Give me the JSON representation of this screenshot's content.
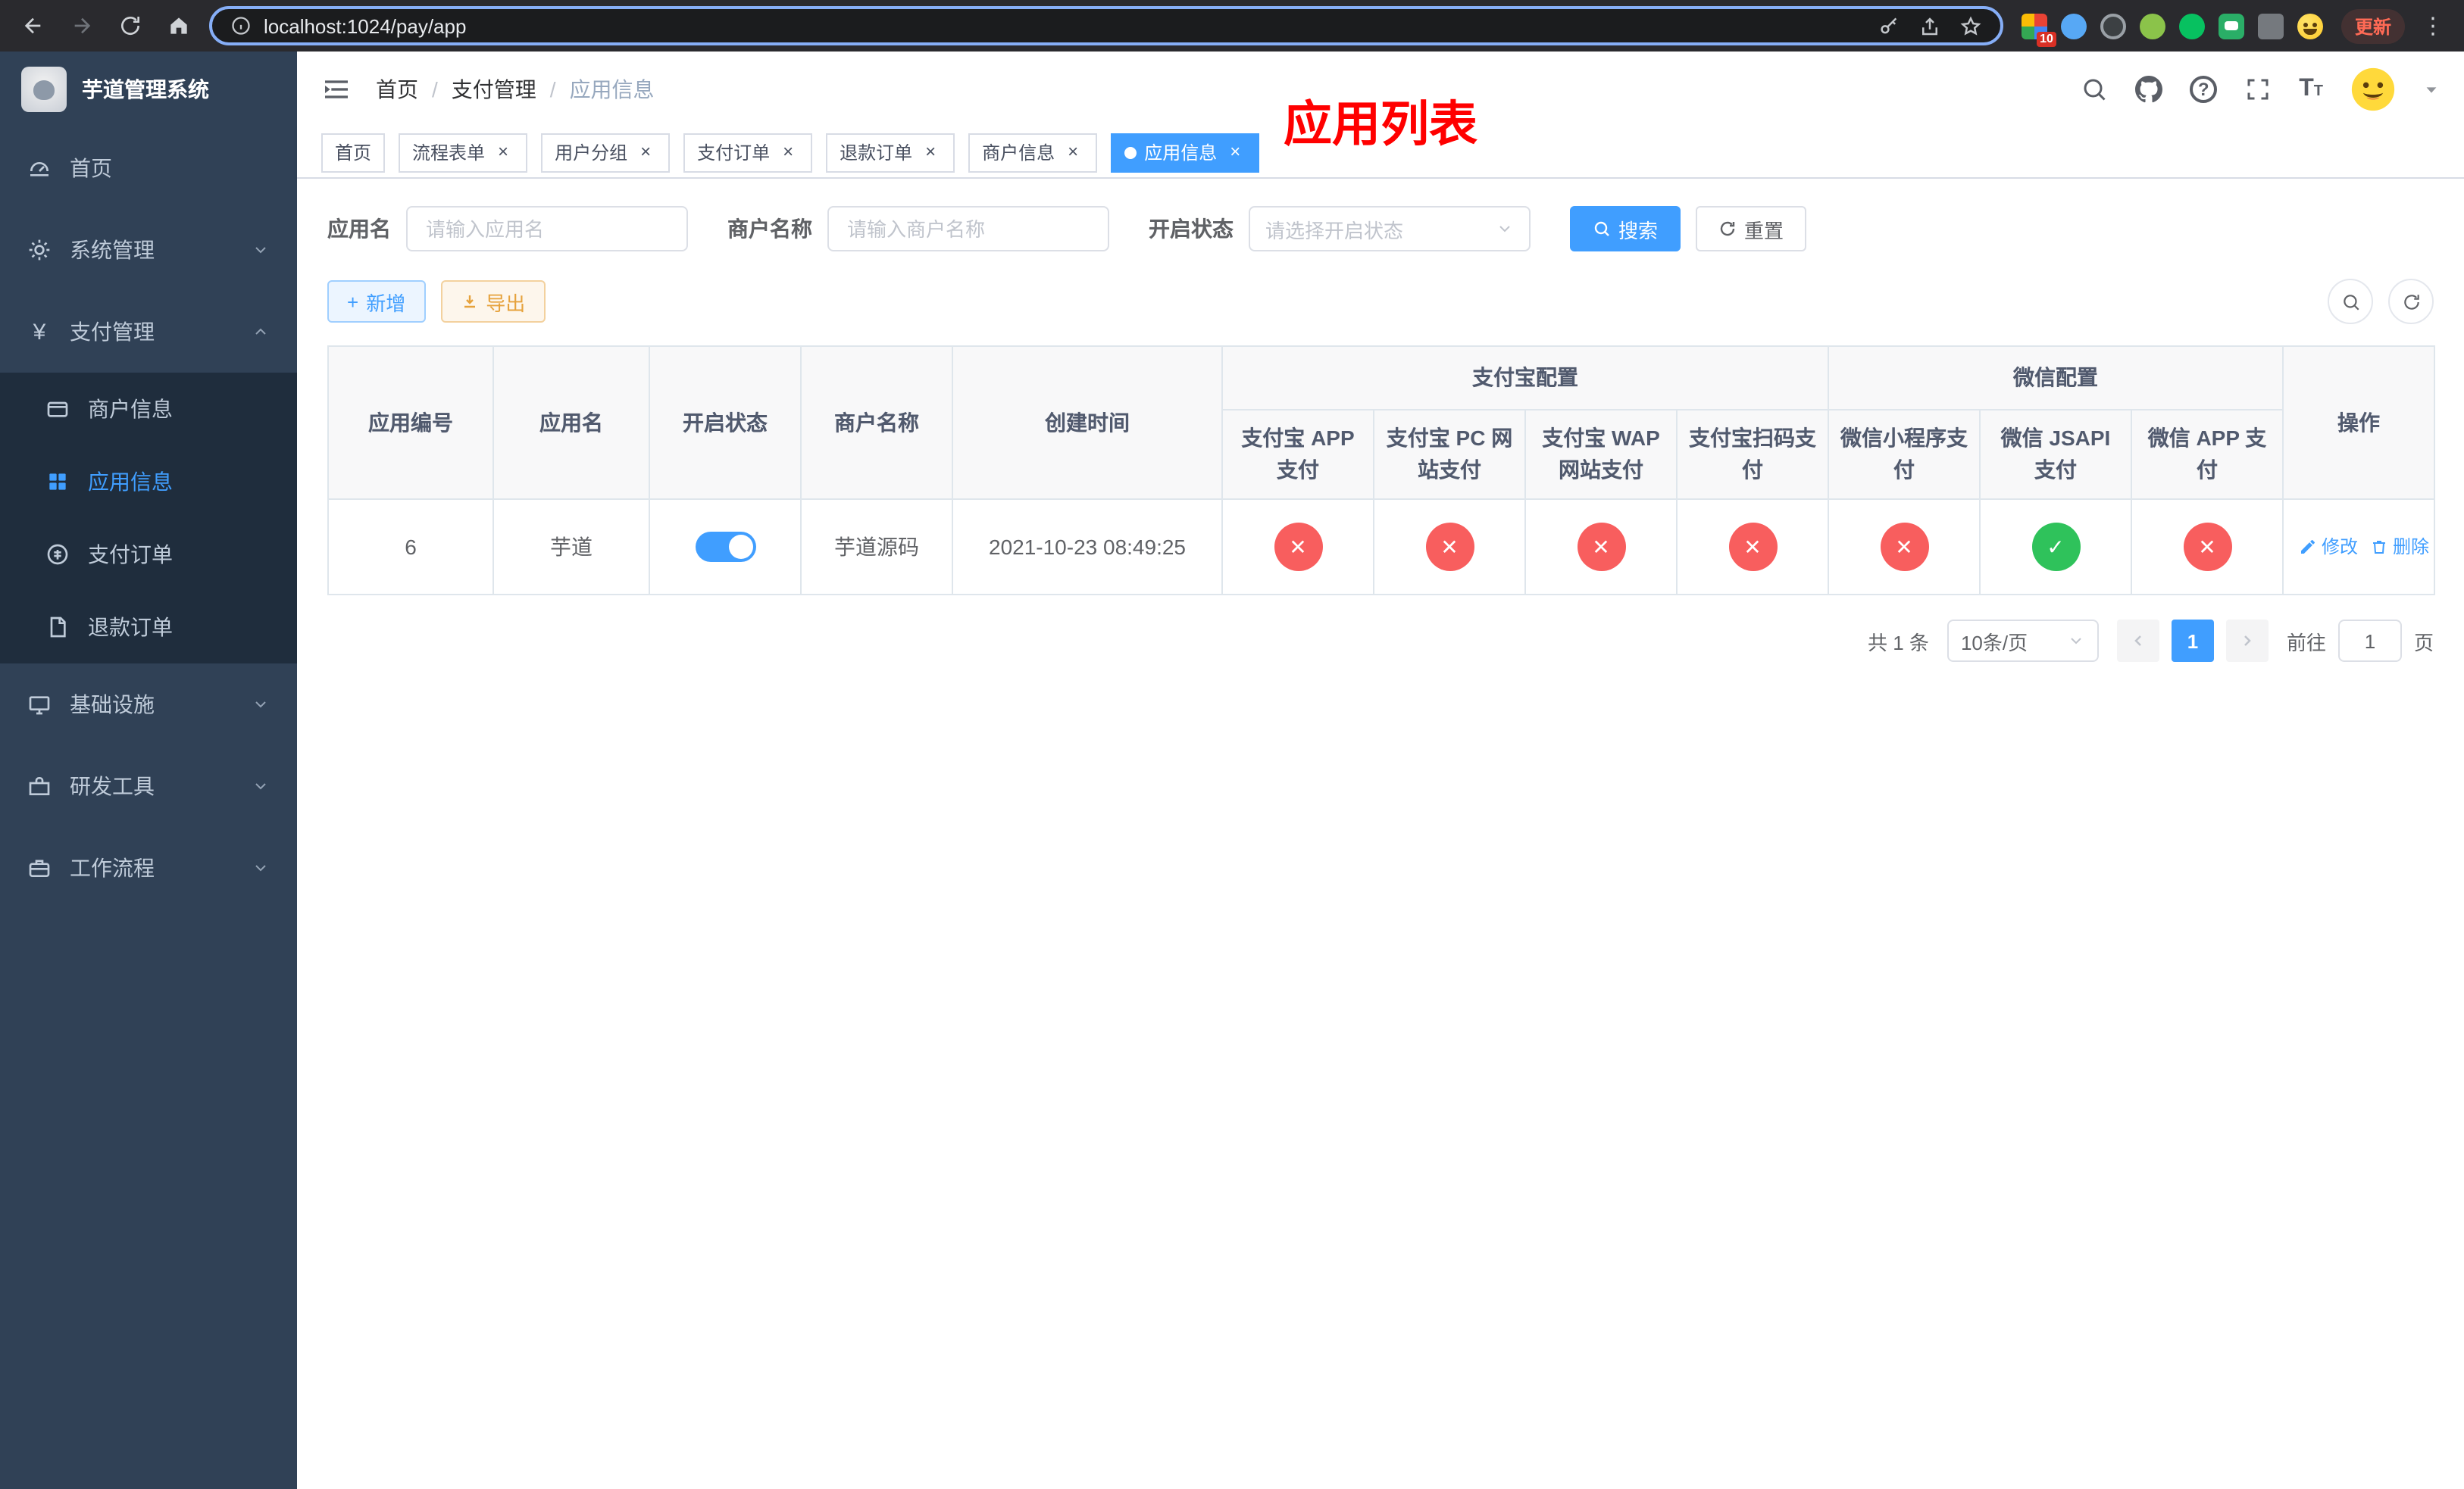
{
  "browser": {
    "url": "localhost:1024/pay/app",
    "update_label": "更新",
    "extension_badge": "10"
  },
  "icons": {
    "close": "×",
    "kebab": "⋮",
    "help": "?",
    "plus": "+",
    "yen": "¥",
    "font_size_big": "T",
    "font_size_small": "T"
  },
  "sidebar": {
    "title": "芋道管理系统",
    "items": [
      {
        "label": "首页"
      },
      {
        "label": "系统管理"
      },
      {
        "label": "支付管理"
      },
      {
        "label": "基础设施"
      },
      {
        "label": "研发工具"
      },
      {
        "label": "工作流程"
      }
    ],
    "payment_children": [
      {
        "label": "商户信息"
      },
      {
        "label": "应用信息",
        "active": true
      },
      {
        "label": "支付订单"
      },
      {
        "label": "退款订单"
      }
    ]
  },
  "navbar": {
    "breadcrumb": [
      "首页",
      "支付管理",
      "应用信息"
    ],
    "page_title": "应用列表"
  },
  "tabs": [
    {
      "label": "首页"
    },
    {
      "label": "流程表单"
    },
    {
      "label": "用户分组"
    },
    {
      "label": "支付订单"
    },
    {
      "label": "退款订单"
    },
    {
      "label": "商户信息"
    },
    {
      "label": "应用信息",
      "active": true
    }
  ],
  "filters": {
    "app_name_label": "应用名",
    "app_name_placeholder": "请输入应用名",
    "merchant_label": "商户名称",
    "merchant_placeholder": "请输入商户名称",
    "status_label": "开启状态",
    "status_placeholder": "请选择开启状态",
    "search_label": "搜索",
    "reset_label": "重置"
  },
  "toolbar": {
    "add_label": "新增",
    "export_label": "导出"
  },
  "table": {
    "col_app_id": "应用编号",
    "col_app_name": "应用名",
    "col_status": "开启状态",
    "col_merchant": "商户名称",
    "col_created": "创建时间",
    "col_actions": "操作",
    "alipay_group": "支付宝配置",
    "wechat_group": "微信配置",
    "alipay_columns": [
      "支付宝 APP 支付",
      "支付宝 PC 网站支付",
      "支付宝 WAP 网站支付",
      "支付宝扫码支付"
    ],
    "wechat_columns": [
      "微信小程序支付",
      "微信 JSAPI 支付",
      "微信 APP 支付"
    ],
    "rows": [
      {
        "id": "6",
        "name": "芋道",
        "enabled": true,
        "merchant": "芋道源码",
        "created": "2021-10-23 08:49:25",
        "statuses": [
          "closed",
          "closed",
          "closed",
          "closed",
          "closed",
          "open",
          "closed"
        ],
        "actions": {
          "edit": "修改",
          "delete": "删除"
        }
      }
    ]
  },
  "pagination": {
    "total_text": "共 1 条",
    "page_size": "10条/页",
    "current_page": "1",
    "goto_label": "前往",
    "page_label": "页",
    "goto_value": "1"
  },
  "colors": {
    "accent": "#409eff",
    "title_red": "#ff0000",
    "status_closed": "#f85e5e",
    "status_open": "#2fc25b",
    "sidebar_bg": "#304156",
    "submenu_bg": "#1f2d3d"
  }
}
